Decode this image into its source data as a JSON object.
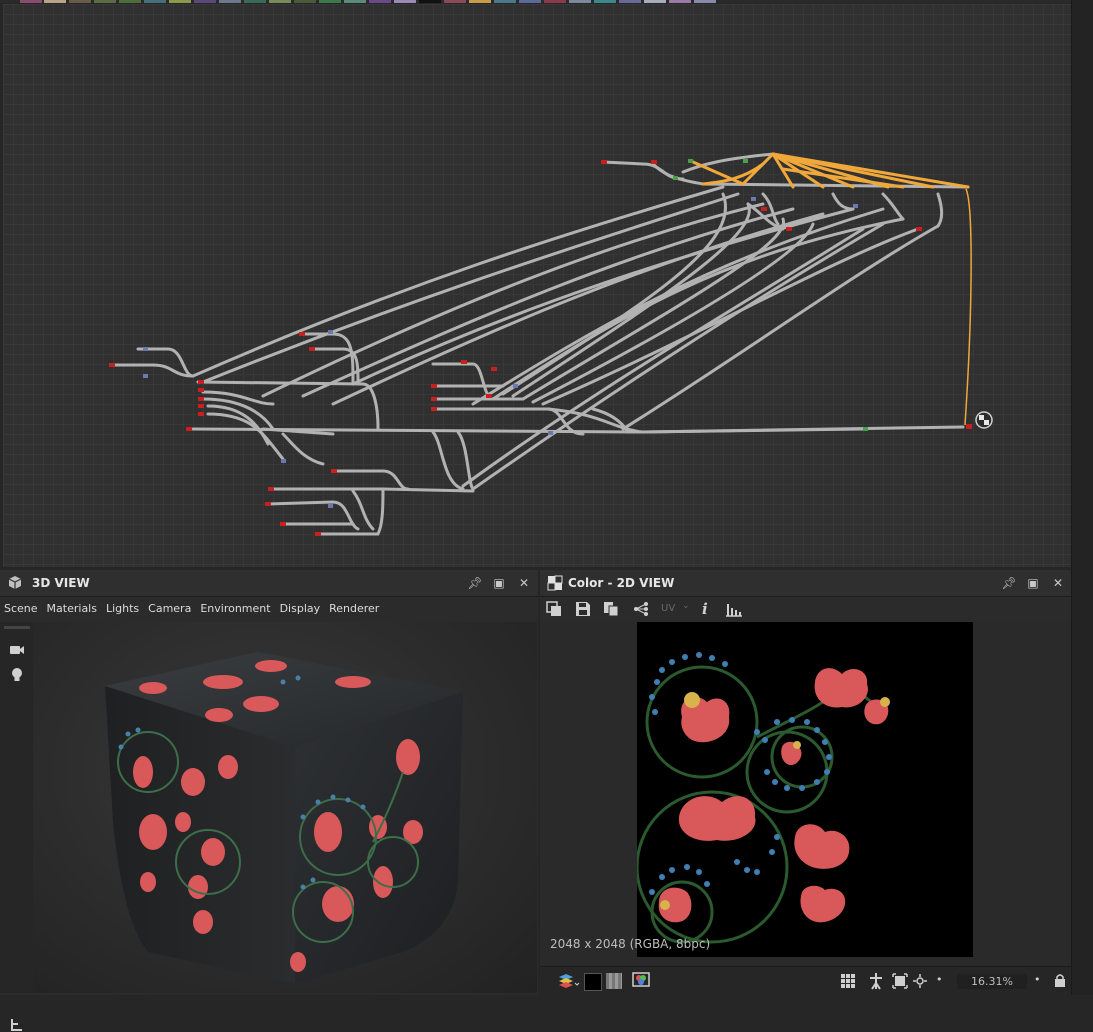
{
  "panel3d": {
    "title": "3D VIEW",
    "menu": [
      "Scene",
      "Materials",
      "Lights",
      "Camera",
      "Environment",
      "Display",
      "Renderer"
    ],
    "side_icons": [
      "camera-icon",
      "lightbulb-icon"
    ],
    "bottom_icon": "outliner-icon"
  },
  "panel2d": {
    "title": "Color - 2D VIEW",
    "toolbar_icons": [
      "export-icon",
      "save-icon",
      "copy-icon",
      "graph-link-icon",
      "uv-icon",
      "info-icon",
      "histogram-icon"
    ],
    "uv_label": "UV",
    "info_label": "i",
    "resolution": "2048 x 2048 (RGBA, 8bpc)",
    "zoom": "16.31%"
  },
  "colors": {
    "background": "#262626",
    "graph_bg": "#303030",
    "wire": "#b9b9b9",
    "wire_selected": "#f0a83a",
    "flower": "#d9585a"
  }
}
